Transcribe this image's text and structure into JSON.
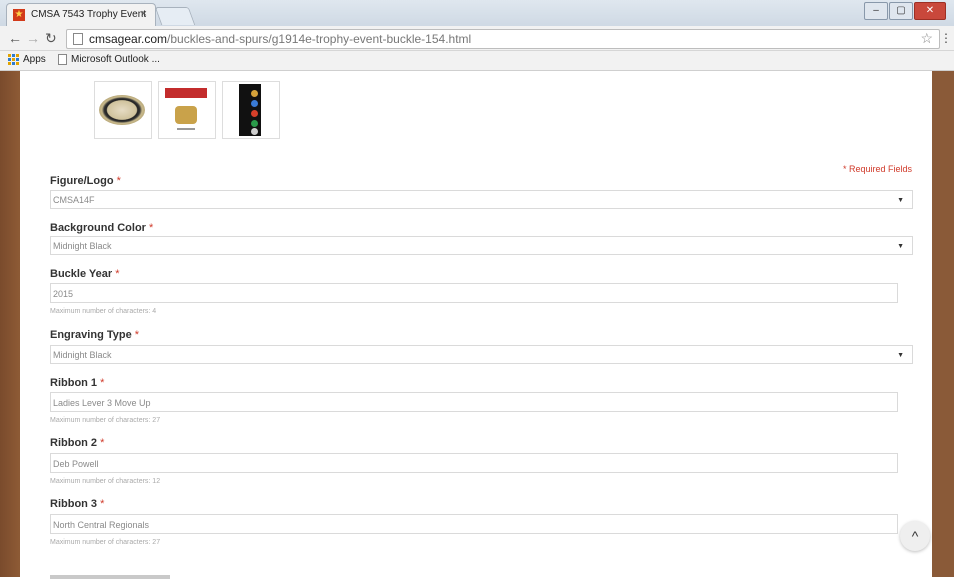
{
  "browser": {
    "tab_title": "CMSA 7543 Trophy Event",
    "tab_close": "×",
    "url_host": "cmsagear.com",
    "url_path": "/buckles-and-spurs/g1914e-trophy-event-buckle-154.html",
    "bookmarks": [
      "Apps",
      "Microsoft Outlook ..."
    ]
  },
  "page": {
    "required_note": "* Required Fields",
    "fields": {
      "figure_logo": {
        "label": "Figure/Logo",
        "value": "CMSA14F"
      },
      "background_color": {
        "label": "Background Color",
        "value": "Midnight Black"
      },
      "buckle_year": {
        "label": "Buckle Year",
        "value": "2015",
        "help": "Maximum number of characters: 4"
      },
      "engraving_type": {
        "label": "Engraving Type",
        "value": "Midnight Black"
      },
      "ribbon_1": {
        "label": "Ribbon 1",
        "value": "Ladies Lever 3 Move Up",
        "help": "Maximum number of characters: 27"
      },
      "ribbon_2": {
        "label": "Ribbon 2",
        "value": "Deb Powell",
        "help": "Maximum number of characters: 12"
      },
      "ribbon_3": {
        "label": "Ribbon 3",
        "value": "North Central Regionals",
        "help": "Maximum number of characters: 27"
      }
    },
    "req_marker": "*",
    "select_arrow": "▼",
    "scroll_top_icon": "^"
  },
  "colors": {
    "required": "#d03a2a",
    "wood": "#7a4b2c"
  },
  "icons": [
    "back-icon",
    "forward-icon",
    "reload-icon",
    "star-icon",
    "apps-icon",
    "page-icon",
    "scroll-top-icon"
  ]
}
